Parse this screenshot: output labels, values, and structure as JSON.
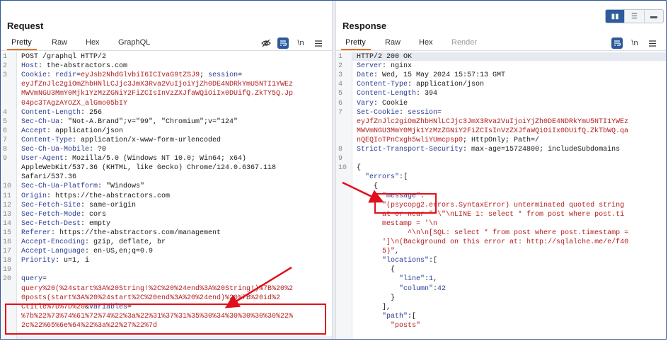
{
  "request": {
    "title": "Request",
    "tabs": [
      "Pretty",
      "Raw",
      "Hex",
      "GraphQL"
    ],
    "active_tab": "Pretty",
    "icons": [
      "eye-off-icon",
      "wrap-icon",
      "newline-icon",
      "menu-icon"
    ],
    "newline_label": "\\n",
    "lines": [
      {
        "n": "1",
        "parts": [
          [
            "b",
            "POST /graphql HTTP/2"
          ]
        ]
      },
      {
        "n": "2",
        "parts": [
          [
            "k",
            "Host"
          ],
          [
            "b",
            ": the-abstractors.com"
          ]
        ]
      },
      {
        "n": "3",
        "parts": [
          [
            "k",
            "Cookie"
          ],
          [
            "b",
            ": "
          ],
          [
            "k",
            "redir"
          ],
          [
            "b",
            "="
          ],
          [
            "r",
            "eyJsb2NhdGlvbiI6ICIvaG9tZSJ9"
          ],
          [
            "b",
            "; "
          ],
          [
            "k",
            "session"
          ],
          [
            "b",
            "="
          ]
        ]
      },
      {
        "n": "",
        "parts": [
          [
            "r",
            "eyJfZnJlc2giOmZhbHNlLCJjc3JmX3Rva2VuIjoiYjZh0DE4NDRkYmU5NTI1YWEz"
          ]
        ]
      },
      {
        "n": "",
        "parts": [
          [
            "r",
            "MWVmNGU3MmY0Mjk1YzMzZGNiY2FiZCIsInVzZXJfaWQiOiIx0DUifQ.ZkTY5Q.Jp"
          ]
        ]
      },
      {
        "n": "",
        "parts": [
          [
            "r",
            "04pc3TAgzAYOZX_alGmo05bIY"
          ]
        ]
      },
      {
        "n": "4",
        "parts": [
          [
            "k",
            "Content-Length"
          ],
          [
            "b",
            ": 256"
          ]
        ]
      },
      {
        "n": "5",
        "parts": [
          [
            "k",
            "Sec-Ch-Ua"
          ],
          [
            "b",
            ": \"Not-A.Brand\";v=\"99\", \"Chromium\";v=\"124\""
          ]
        ]
      },
      {
        "n": "6",
        "parts": [
          [
            "k",
            "Accept"
          ],
          [
            "b",
            ": application/json"
          ]
        ]
      },
      {
        "n": "7",
        "parts": [
          [
            "k",
            "Content-Type"
          ],
          [
            "b",
            ": application/x-www-form-urlencoded"
          ]
        ]
      },
      {
        "n": "8",
        "parts": [
          [
            "k",
            "Sec-Ch-Ua-Mobile"
          ],
          [
            "b",
            ": ?0"
          ]
        ]
      },
      {
        "n": "9",
        "parts": [
          [
            "k",
            "User-Agent"
          ],
          [
            "b",
            ": Mozilla/5.0 (Windows NT 10.0; Win64; x64)"
          ]
        ]
      },
      {
        "n": "",
        "parts": [
          [
            "b",
            "AppleWebKit/537.36 (KHTML, like Gecko) Chrome/124.0.6367.118"
          ]
        ]
      },
      {
        "n": "",
        "parts": [
          [
            "b",
            "Safari/537.36"
          ]
        ]
      },
      {
        "n": "10",
        "parts": [
          [
            "k",
            "Sec-Ch-Ua-Platform"
          ],
          [
            "b",
            ": \"Windows\""
          ]
        ]
      },
      {
        "n": "11",
        "parts": [
          [
            "k",
            "Origin"
          ],
          [
            "b",
            ": https://the-abstractors.com"
          ]
        ]
      },
      {
        "n": "12",
        "parts": [
          [
            "k",
            "Sec-Fetch-Site"
          ],
          [
            "b",
            ": same-origin"
          ]
        ]
      },
      {
        "n": "13",
        "parts": [
          [
            "k",
            "Sec-Fetch-Mode"
          ],
          [
            "b",
            ": cors"
          ]
        ]
      },
      {
        "n": "14",
        "parts": [
          [
            "k",
            "Sec-Fetch-Dest"
          ],
          [
            "b",
            ": empty"
          ]
        ]
      },
      {
        "n": "15",
        "parts": [
          [
            "k",
            "Referer"
          ],
          [
            "b",
            ": https://the-abstractors.com/management"
          ]
        ]
      },
      {
        "n": "16",
        "parts": [
          [
            "k",
            "Accept-Encoding"
          ],
          [
            "b",
            ": gzip, deflate, br"
          ]
        ]
      },
      {
        "n": "17",
        "parts": [
          [
            "k",
            "Accept-Language"
          ],
          [
            "b",
            ": en-US,en;q=0.9"
          ]
        ]
      },
      {
        "n": "18",
        "parts": [
          [
            "k",
            "Priority"
          ],
          [
            "b",
            ": u=1, i"
          ]
        ]
      },
      {
        "n": "19",
        "parts": [
          [
            "b",
            ""
          ]
        ]
      },
      {
        "n": "20",
        "parts": [
          [
            "k",
            "query"
          ],
          [
            "b",
            "="
          ]
        ]
      },
      {
        "n": "",
        "parts": [
          [
            "r",
            "query%20(%24start%3A%20String!%2C%20%24end%3A%20String!)%7B%20%2"
          ]
        ]
      },
      {
        "n": "",
        "parts": [
          [
            "r",
            "0posts(start%3A%20%24start%2C%20end%3A%20%24end)%20%7B%20id%2"
          ]
        ]
      },
      {
        "n": "",
        "parts": [
          [
            "r",
            "Ctitle%7D%7D%20"
          ],
          [
            "b",
            "&"
          ],
          [
            "k",
            "variables"
          ],
          [
            "b",
            "="
          ]
        ]
      },
      {
        "n": "",
        "parts": [
          [
            "r",
            "%7b%22%73%74%61%72%74%22%3a%22%31%37%31%35%30%34%30%30%30%30%22%"
          ]
        ]
      },
      {
        "n": "",
        "parts": [
          [
            "r",
            "2c%22%65%6e%64%22%3a%22%27%22%7d"
          ]
        ]
      }
    ]
  },
  "response": {
    "title": "Response",
    "tabs": [
      "Pretty",
      "Raw",
      "Hex",
      "Render"
    ],
    "active_tab": "Pretty",
    "icons": [
      "wrap-icon",
      "newline-icon",
      "menu-icon"
    ],
    "newline_label": "\\n",
    "layout_toggle": [
      "split-horizontal-icon",
      "split-vertical-icon",
      "single-pane-icon"
    ],
    "lines": [
      {
        "n": "1",
        "parts": [
          [
            "b",
            "HTTP/2 200 OK"
          ]
        ]
      },
      {
        "n": "2",
        "parts": [
          [
            "k",
            "Server"
          ],
          [
            "b",
            ": nginx"
          ]
        ]
      },
      {
        "n": "3",
        "parts": [
          [
            "k",
            "Date"
          ],
          [
            "b",
            ": Wed, 15 May 2024 15:57:13 GMT"
          ]
        ]
      },
      {
        "n": "4",
        "parts": [
          [
            "k",
            "Content-Type"
          ],
          [
            "b",
            ": application/json"
          ]
        ]
      },
      {
        "n": "5",
        "parts": [
          [
            "k",
            "Content-Length"
          ],
          [
            "b",
            ": 394"
          ]
        ]
      },
      {
        "n": "6",
        "parts": [
          [
            "k",
            "Vary"
          ],
          [
            "b",
            ": Cookie"
          ]
        ]
      },
      {
        "n": "7",
        "parts": [
          [
            "k",
            "Set-Cookie"
          ],
          [
            "b",
            ": "
          ],
          [
            "k",
            "session"
          ],
          [
            "b",
            "="
          ]
        ]
      },
      {
        "n": "",
        "parts": [
          [
            "r",
            "eyJfZnJlc2giOmZhbHNlLCJjc3JmX3Rva2VuIjoiYjZh0DE4NDRkYmU5NTI1YWEz"
          ]
        ]
      },
      {
        "n": "",
        "parts": [
          [
            "r",
            "MWVmNGU3MmY0Mjk1YzMzZGNiY2FiZCIsInVzZXJfaWQiOiIx0DUifQ.ZkTbWQ.qa"
          ]
        ]
      },
      {
        "n": "",
        "parts": [
          [
            "r",
            "nQEQIoTPnCxgh5wliYUmcpsp0"
          ],
          [
            "b",
            "; HttpOnly; Path=/"
          ]
        ]
      },
      {
        "n": "8",
        "parts": [
          [
            "k",
            "Strict-Transport-Security"
          ],
          [
            "b",
            ": max-age=15724800; includeSubdomains"
          ]
        ]
      },
      {
        "n": "9",
        "parts": [
          [
            "b",
            ""
          ]
        ]
      },
      {
        "n": "10",
        "parts": [
          [
            "b",
            "{"
          ]
        ]
      },
      {
        "n": "",
        "parts": [
          [
            "b",
            "  "
          ],
          [
            "h",
            "\"errors\""
          ],
          [
            "b",
            ":["
          ]
        ]
      },
      {
        "n": "",
        "parts": [
          [
            "b",
            "    {"
          ]
        ]
      },
      {
        "n": "",
        "parts": [
          [
            "b",
            "      "
          ],
          [
            "h",
            "\"message\""
          ],
          [
            "b",
            ":"
          ]
        ]
      },
      {
        "n": "",
        "parts": [
          [
            "b",
            "      "
          ],
          [
            "r",
            "\"(psycopg2.errors.SyntaxError) unterminated quoted string"
          ]
        ]
      },
      {
        "n": "",
        "parts": [
          [
            "b",
            "      "
          ],
          [
            "r",
            "at or near \"'\\\"\\nLINE 1: select * from post where post.ti"
          ]
        ]
      },
      {
        "n": "",
        "parts": [
          [
            "b",
            "      "
          ],
          [
            "r",
            "mestamp = '\\n"
          ]
        ]
      },
      {
        "n": "",
        "parts": [
          [
            "b",
            "      "
          ],
          [
            "r",
            "      ^\\n\\n[SQL: select * from post where post.timestamp ="
          ]
        ]
      },
      {
        "n": "",
        "parts": [
          [
            "b",
            "      "
          ],
          [
            "r",
            "']\\n(Background on this error at: http://sqlalche.me/e/f40"
          ]
        ]
      },
      {
        "n": "",
        "parts": [
          [
            "b",
            "      "
          ],
          [
            "r",
            "5)\""
          ],
          [
            "b",
            ","
          ]
        ]
      },
      {
        "n": "",
        "parts": [
          [
            "b",
            "      "
          ],
          [
            "h",
            "\"locations\""
          ],
          [
            "b",
            ":["
          ]
        ]
      },
      {
        "n": "",
        "parts": [
          [
            "b",
            "        {"
          ]
        ]
      },
      {
        "n": "",
        "parts": [
          [
            "b",
            "          "
          ],
          [
            "h",
            "\"line\""
          ],
          [
            "b",
            ":"
          ],
          [
            "h",
            "1"
          ],
          [
            "b",
            ","
          ]
        ]
      },
      {
        "n": "",
        "parts": [
          [
            "b",
            "          "
          ],
          [
            "h",
            "\"column\""
          ],
          [
            "b",
            ":"
          ],
          [
            "h",
            "42"
          ]
        ]
      },
      {
        "n": "",
        "parts": [
          [
            "b",
            "        }"
          ]
        ]
      },
      {
        "n": "",
        "parts": [
          [
            "b",
            "      ],"
          ]
        ]
      },
      {
        "n": "",
        "parts": [
          [
            "b",
            "      "
          ],
          [
            "h",
            "\"path\""
          ],
          [
            "b",
            ":["
          ]
        ]
      },
      {
        "n": "",
        "parts": [
          [
            "b",
            "        "
          ],
          [
            "r",
            "\"posts\""
          ]
        ]
      }
    ]
  }
}
